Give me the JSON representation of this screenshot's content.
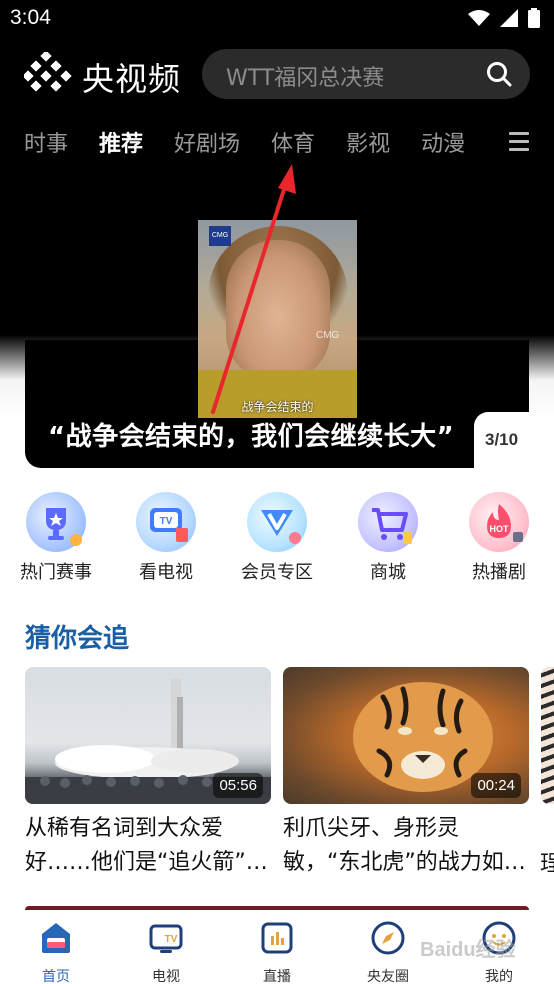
{
  "status_bar": {
    "time": "3:04"
  },
  "header": {
    "app_name": "央视频",
    "search_placeholder": "WTT福冈总决赛"
  },
  "tabs": [
    {
      "label": "时事",
      "active": false
    },
    {
      "label": "推荐",
      "active": true
    },
    {
      "label": "好剧场",
      "active": false
    },
    {
      "label": "体育",
      "active": false
    },
    {
      "label": "影视",
      "active": false
    },
    {
      "label": "动漫",
      "active": false
    }
  ],
  "banner": {
    "headline": "“战争会结束的，我们会继续长大”",
    "counter": "3/10",
    "thumb_caption": "战争会结束的",
    "thumb_badge": "CMG",
    "thumb_watermark": "CMG"
  },
  "quick_icons": [
    {
      "label": "热门赛事",
      "icon": "trophy-icon"
    },
    {
      "label": "看电视",
      "icon": "tv-icon"
    },
    {
      "label": "会员专区",
      "icon": "vip-icon"
    },
    {
      "label": "商城",
      "icon": "cart-icon"
    },
    {
      "label": "热播剧",
      "icon": "hot-icon"
    }
  ],
  "section": {
    "title": "猜你会追",
    "cards": [
      {
        "duration": "05:56",
        "title_line1": "从稀有名词到大众爱",
        "title_line2": "好……他们是“追火箭”…"
      },
      {
        "duration": "00:24",
        "title_line1": "利爪尖牙、身形灵",
        "title_line2": "敏，“东北虎”的战力如…"
      }
    ],
    "peek_char": "珵"
  },
  "bottom_nav": [
    {
      "label": "首页",
      "icon": "home-icon",
      "active": true
    },
    {
      "label": "电视",
      "icon": "tv-nav-icon",
      "active": false
    },
    {
      "label": "直播",
      "icon": "live-icon",
      "active": false
    },
    {
      "label": "央友圈",
      "icon": "compass-icon",
      "active": false
    },
    {
      "label": "我的",
      "icon": "profile-icon",
      "active": false
    }
  ],
  "watermark_text": "Baidu经验",
  "colors": {
    "accent": "#2767b8",
    "section_title": "#1a5fa6",
    "arrow": "#e8262b"
  }
}
